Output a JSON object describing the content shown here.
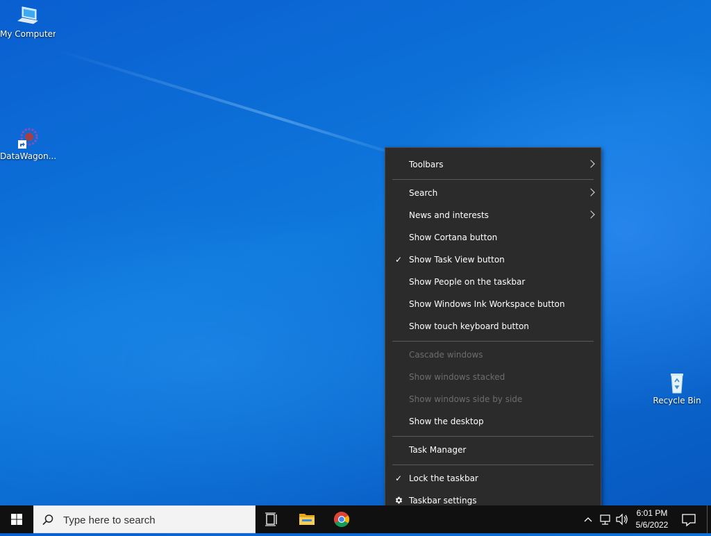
{
  "desktop": {
    "icons": [
      {
        "label": "My Computer",
        "icon": "computer-icon"
      },
      {
        "label": "DataWagon...",
        "icon": "datawagon-shortcut-icon"
      },
      {
        "label": "Recycle Bin",
        "icon": "recycle-bin-icon"
      }
    ]
  },
  "context_menu": {
    "items": [
      {
        "label": "Toolbars",
        "submenu": true
      },
      {
        "label": "Search",
        "submenu": true
      },
      {
        "label": "News and interests",
        "submenu": true
      },
      {
        "label": "Show Cortana button"
      },
      {
        "label": "Show Task View button",
        "checked": true
      },
      {
        "label": "Show People on the taskbar"
      },
      {
        "label": "Show Windows Ink Workspace button"
      },
      {
        "label": "Show touch keyboard button"
      },
      {
        "label": "Cascade windows",
        "disabled": true
      },
      {
        "label": "Show windows stacked",
        "disabled": true
      },
      {
        "label": "Show windows side by side",
        "disabled": true
      },
      {
        "label": "Show the desktop"
      },
      {
        "label": "Task Manager"
      },
      {
        "label": "Lock the taskbar",
        "checked": true
      },
      {
        "label": "Taskbar settings",
        "icon": "gear-icon"
      }
    ]
  },
  "taskbar": {
    "search_placeholder": "Type here to search",
    "clock_time": "6:01 PM",
    "clock_date": "5/6/2022"
  },
  "colors": {
    "menu_bg": "#2b2b2b",
    "taskbar_bg": "#101010",
    "disabled_text": "#6d6d6d"
  }
}
